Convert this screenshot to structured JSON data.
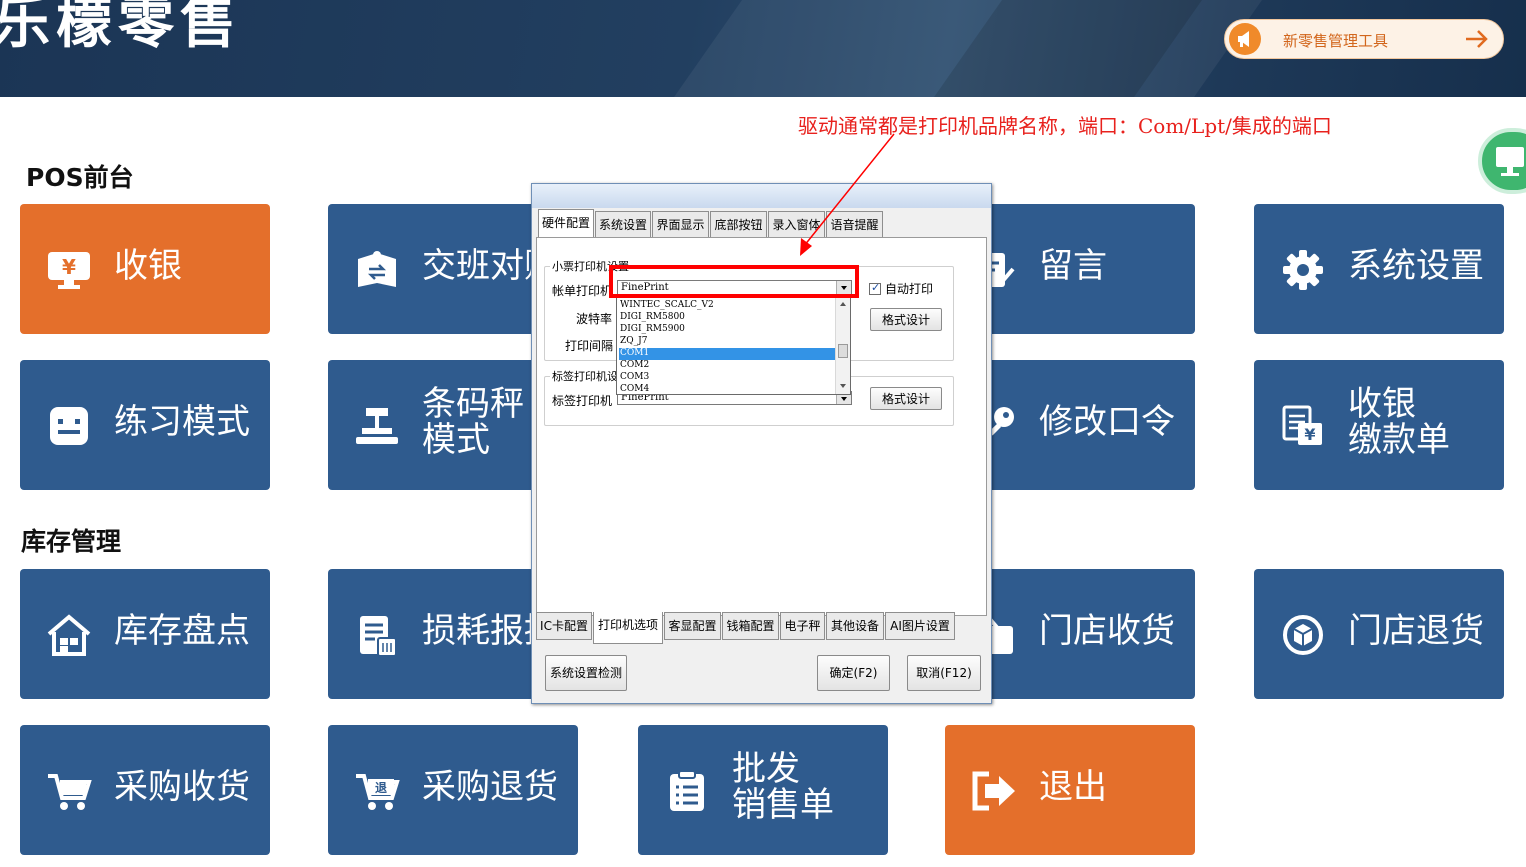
{
  "header": {
    "brand_title": "乐檬零售",
    "tool_button_label": "新零售管理工具"
  },
  "annotation": "驱动通常都是打印机品牌名称，端口：Com/Lpt/集成的端口",
  "sections": {
    "pos": "POS前台",
    "inventory": "库存管理"
  },
  "tiles": {
    "cashier": "收银",
    "shift_handover": "交班对账",
    "message": "留言",
    "system_settings": "系统设置",
    "practice_mode": "练习模式",
    "barcode_scale_line1": "条码秤",
    "barcode_scale_line2": "模式",
    "change_password": "修改口令",
    "payment_slip_line1": "收银",
    "payment_slip_line2": "缴款单",
    "stocktake": "库存盘点",
    "loss_report": "损耗报损",
    "store_receiving": "门店收货",
    "store_return": "门店退货",
    "purchase_receiving": "采购收货",
    "purchase_return": "采购退货",
    "wholesale_line1": "批发",
    "wholesale_line2": "销售单",
    "exit": "退出"
  },
  "dialog": {
    "top_tabs": [
      "硬件配置",
      "系统设置",
      "界面显示",
      "底部按钮",
      "录入窗体",
      "语音提醒"
    ],
    "receipt_group_title": "小票打印机设置",
    "bill_printer_label": "帐单打印机",
    "bill_printer_value": "FinePrint",
    "auto_print_label": "自动打印",
    "auto_print_checked": true,
    "baud_rate_label": "波特率",
    "print_interval_label": "打印间隔",
    "format_design_label": "格式设计",
    "label_group_title": "标签打印机设置",
    "label_printer_label": "标签打印机",
    "label_printer_value": "FinePrint",
    "dropdown_options": [
      "WINTEC_SCALC_V2",
      "DIGI_RM5800",
      "DIGI_RM5900",
      "ZQ_J7",
      "COM1",
      "COM2",
      "COM3",
      "COM4"
    ],
    "dropdown_selected": "COM1",
    "bottom_tabs": [
      "IC卡配置",
      "打印机选项",
      "客显配置",
      "钱箱配置",
      "电子秤",
      "其他设备",
      "AI图片设置"
    ],
    "check_button": "系统设置检测",
    "ok_button": "确定(F2)",
    "cancel_button": "取消(F12)"
  },
  "colors": {
    "tile_blue": "#2f5b8e",
    "tile_orange": "#e46f2b",
    "annotation_red": "#e8211d",
    "highlight_red": "#ff0000"
  }
}
